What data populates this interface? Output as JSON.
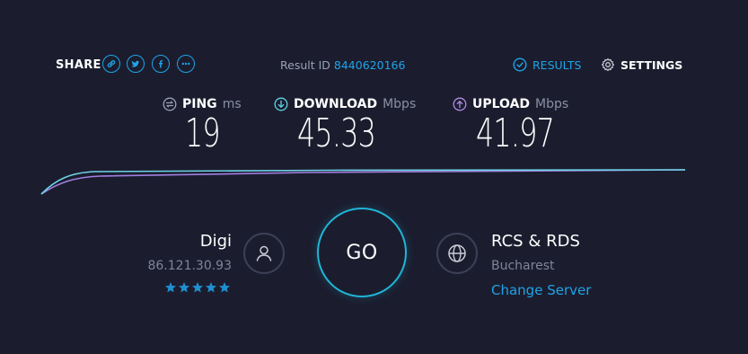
{
  "header": {
    "share_label": "SHARE",
    "share_icons": [
      "link-icon",
      "twitter-icon",
      "facebook-icon",
      "more-icon"
    ],
    "result_label": "Result ID",
    "result_id": "8440620166",
    "results_label": "RESULTS",
    "settings_label": "SETTINGS"
  },
  "metrics": {
    "ping": {
      "label": "PING",
      "unit": "ms",
      "value": "19",
      "icon": "ping-icon"
    },
    "download": {
      "label": "DOWNLOAD",
      "unit": "Mbps",
      "value": "45.33",
      "icon": "download-icon"
    },
    "upload": {
      "label": "UPLOAD",
      "unit": "Mbps",
      "value": "41.97",
      "icon": "upload-icon"
    }
  },
  "isp": {
    "name": "Digi",
    "ip": "86.121.30.93",
    "rating": 5
  },
  "go_label": "GO",
  "server": {
    "name": "RCS & RDS",
    "city": "Bucharest",
    "change_label": "Change Server"
  },
  "colors": {
    "background": "#1b1d2e",
    "accent": "#1fa3e8",
    "download_line": "#6fd3e8",
    "upload_line": "#a27fe0"
  }
}
